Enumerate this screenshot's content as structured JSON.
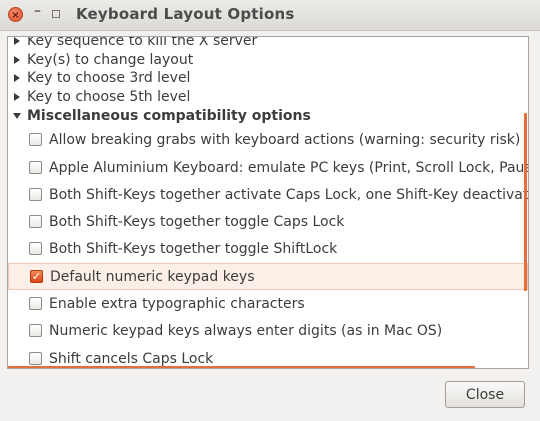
{
  "window": {
    "title": "Keyboard Layout Options",
    "close_glyph": "×",
    "minimize_glyph": "–"
  },
  "tree": {
    "groups": [
      {
        "label": "Key sequence to kill the X server",
        "expanded": false
      },
      {
        "label": "Key(s) to change layout",
        "expanded": false
      },
      {
        "label": "Key to choose 3rd level",
        "expanded": false
      },
      {
        "label": "Key to choose 5th level",
        "expanded": false
      },
      {
        "label": "Miscellaneous compatibility options",
        "expanded": true
      }
    ],
    "options": [
      {
        "label": "Allow breaking grabs with keyboard actions (warning: security risk)",
        "checked": false
      },
      {
        "label": "Apple Aluminium Keyboard: emulate PC keys (Print, Scroll Lock, Pause, N",
        "checked": false
      },
      {
        "label": "Both Shift-Keys together activate Caps Lock, one Shift-Key deactivates",
        "checked": false
      },
      {
        "label": "Both Shift-Keys together toggle Caps Lock",
        "checked": false
      },
      {
        "label": "Both Shift-Keys together toggle ShiftLock",
        "checked": false
      },
      {
        "label": "Default numeric keypad keys",
        "checked": true
      },
      {
        "label": "Enable extra typographic characters",
        "checked": false
      },
      {
        "label": "Numeric keypad keys always enter digits (as in Mac OS)",
        "checked": false
      },
      {
        "label": "Shift cancels Caps Lock",
        "checked": false
      }
    ]
  },
  "footer": {
    "close_label": "Close"
  },
  "colors": {
    "accent": "#dd4814",
    "selection_bg": "#fcefe8"
  }
}
